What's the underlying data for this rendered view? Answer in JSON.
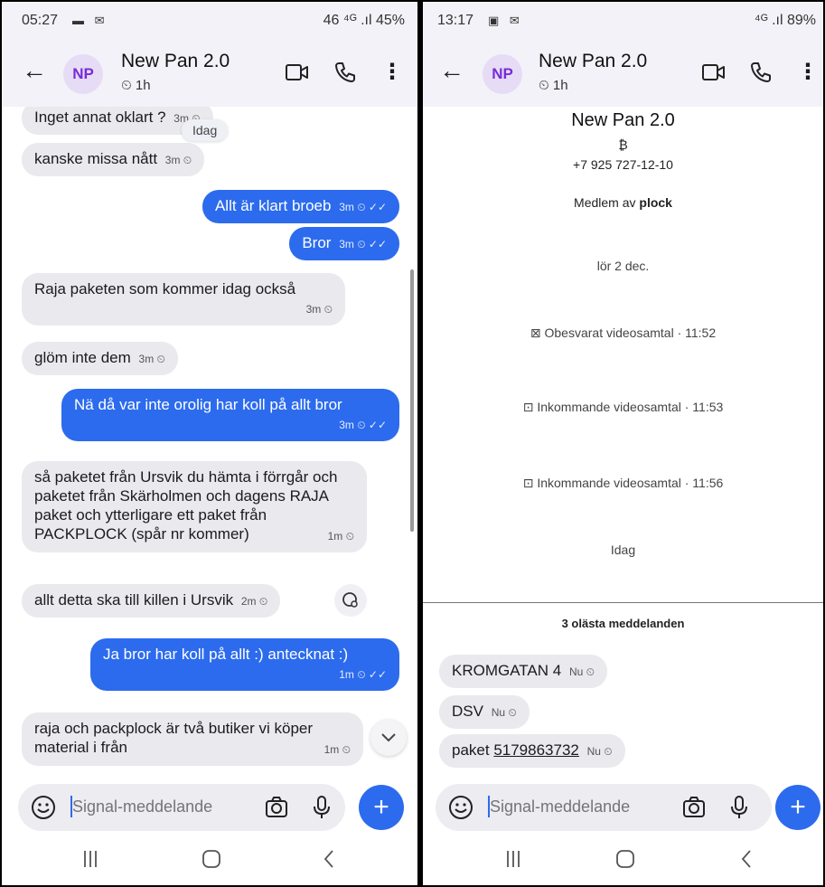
{
  "left": {
    "status": {
      "time": "05:27",
      "notif_icons": "▬ ✉",
      "right": "46 ⁴ᴳ .ıl 45%"
    },
    "header": {
      "avatar": "NP",
      "name": "New Pan 2.0",
      "timer": "1h"
    },
    "date_pill": "Idag",
    "messages": [
      {
        "dir": "in",
        "text": "Inget annat oklart ?",
        "time": "3m"
      },
      {
        "dir": "in",
        "text": "kanske missa nått",
        "time": "3m"
      },
      {
        "dir": "out",
        "text": "Allt är klart broeb",
        "time": "3m"
      },
      {
        "dir": "out",
        "text": "Bror",
        "time": "3m"
      },
      {
        "dir": "in",
        "text": "Raja paketen som kommer idag också",
        "time": "3m"
      },
      {
        "dir": "in",
        "text": "glöm inte dem",
        "time": "3m"
      },
      {
        "dir": "out",
        "text": "Nä då var inte orolig har koll på allt bror",
        "time": "3m"
      },
      {
        "dir": "in",
        "text": "så paketet från Ursvik du hämta i förrgår och paketet från Skärholmen och dagens RAJA paket och ytterligare ett paket från PACKPLOCK (spår nr kommer)",
        "time": "1m"
      },
      {
        "dir": "in",
        "text": "allt detta ska till killen i Ursvik",
        "time": "2m"
      },
      {
        "dir": "out",
        "text": "Ja bror har koll på allt :) antecknat :)",
        "time": "1m"
      },
      {
        "dir": "in",
        "text": "raja och packplock är två butiker vi köper material i från",
        "time": "1m"
      }
    ],
    "composer": {
      "placeholder": "Signal-meddelande"
    }
  },
  "right": {
    "status": {
      "time": "13:17",
      "notif_icons": "▣ ✉",
      "right": "⁴ᴳ .ıl 89%"
    },
    "header": {
      "avatar": "NP",
      "name": "New Pan 2.0",
      "timer": "1h"
    },
    "profile": {
      "name": "New Pan 2.0",
      "symbol": "₿",
      "phone": "+7 925 727-12-10",
      "member_prefix": "Medlem av",
      "member_group": "plock"
    },
    "events": [
      {
        "kind": "date",
        "text": "lör 2 dec."
      },
      {
        "kind": "call",
        "icon": "missed-video-call-icon",
        "text": "Obesvarat videosamtal · 11:52"
      },
      {
        "kind": "call",
        "icon": "incoming-video-call-icon",
        "text": "Inkommande videosamtal · 11:53"
      },
      {
        "kind": "call",
        "icon": "incoming-video-call-icon",
        "text": "Inkommande videosamtal · 11:56"
      },
      {
        "kind": "date",
        "text": "Idag"
      }
    ],
    "unread_label": "3 olästa meddelanden",
    "messages": [
      {
        "dir": "in",
        "text": "KROMGATAN 4",
        "time": "Nu"
      },
      {
        "dir": "in",
        "text": "DSV",
        "time": "Nu"
      },
      {
        "dir": "in",
        "text_prefix": "paket ",
        "link": "5179863732",
        "time": "Nu"
      }
    ],
    "composer": {
      "placeholder": "Signal-meddelande"
    }
  },
  "colors": {
    "accent": "#2c6bed",
    "incoming": "#e9e9ee",
    "avatar_bg": "#e6dcf6",
    "avatar_fg": "#7a2bd6"
  }
}
